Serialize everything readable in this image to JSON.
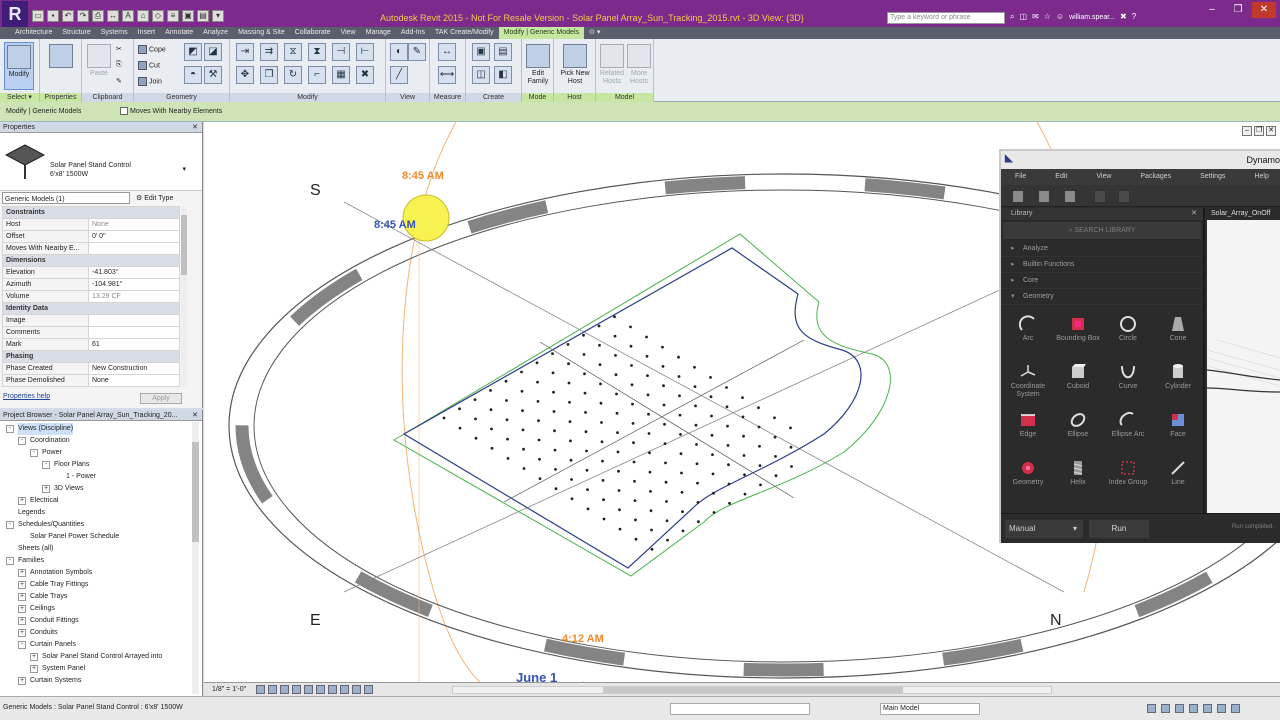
{
  "app": {
    "logo": "R",
    "window_title": "Autodesk Revit 2015 - Not For Resale Version -     Solar Panel Array_Sun_Tracking_2015.rvt - 3D View: {3D}",
    "search_placeholder": "Type a keyword or phrase",
    "user": "william.spear...",
    "colors": {
      "title_bar": "#7c2a8c",
      "title_text": "#f7c84a",
      "context_tab": "#c7e6a2"
    }
  },
  "ribbon_tabs": [
    "Architecture",
    "Structure",
    "Systems",
    "Insert",
    "Annotate",
    "Analyze",
    "Massing & Site",
    "Collaborate",
    "View",
    "Manage",
    "Add-Ins",
    "TAK Create/Modify",
    "Modify | Generic Models"
  ],
  "ribbon": {
    "select": {
      "big": "Modify",
      "label": "Select ▾"
    },
    "properties": {
      "label": "Properties"
    },
    "clipboard": {
      "paste": "Paste",
      "label": "Clipboard"
    },
    "geometry": {
      "cope": "Cope",
      "cut": "Cut",
      "join": "Join",
      "label": "Geometry"
    },
    "modify": {
      "label": "Modify"
    },
    "view": {
      "label": "View"
    },
    "measure": {
      "label": "Measure"
    },
    "create": {
      "label": "Create"
    },
    "mode": {
      "edit_family": "Edit Family",
      "label": "Mode"
    },
    "host": {
      "pick_new_host": "Pick New Host",
      "label": "Host"
    },
    "model": {
      "related_hosts": "Related Hosts",
      "more_hosts": "More Hosts",
      "label": "Model"
    }
  },
  "options_bar": {
    "context": "Modify | Generic Models",
    "moves_with": "Moves With Nearby Elements"
  },
  "properties": {
    "title": "Properties",
    "type_name": "Solar Panel Stand Control",
    "type_sub": "6'x8' 1500W",
    "selector": "Generic Models (1)",
    "edit_type": "Edit Type",
    "rows": [
      {
        "cat": "Constraints"
      },
      {
        "k": "Host",
        "v": "None",
        "gray": true
      },
      {
        "k": "Offset",
        "v": "0' 0\""
      },
      {
        "k": "Moves With Nearby E...",
        "v": ""
      },
      {
        "cat": "Dimensions"
      },
      {
        "k": "Elevation",
        "v": "-41.803°"
      },
      {
        "k": "Azimuth",
        "v": "-104.981°"
      },
      {
        "k": "Volume",
        "v": "13.29 CF",
        "gray": true
      },
      {
        "cat": "Identity Data"
      },
      {
        "k": "Image",
        "v": ""
      },
      {
        "k": "Comments",
        "v": ""
      },
      {
        "k": "Mark",
        "v": "61"
      },
      {
        "cat": "Phasing"
      },
      {
        "k": "Phase Created",
        "v": "New Construction"
      },
      {
        "k": "Phase Demolished",
        "v": "None"
      }
    ],
    "help": "Properties help",
    "apply": "Apply"
  },
  "browser": {
    "title": "Project Browser - Solar Panel Array_Sun_Tracking_20...",
    "nodes": [
      {
        "t": "Views (Discipline)",
        "d": 0,
        "e": "-",
        "hl": true
      },
      {
        "t": "Coordination",
        "d": 1,
        "e": "-"
      },
      {
        "t": "Power",
        "d": 2,
        "e": "-"
      },
      {
        "t": "Floor Plans",
        "d": 3,
        "e": "-"
      },
      {
        "t": "1 - Power",
        "d": 4,
        "e": ""
      },
      {
        "t": "3D Views",
        "d": 3,
        "e": "+"
      },
      {
        "t": "Electrical",
        "d": 1,
        "e": "+"
      },
      {
        "t": "Legends",
        "d": 0,
        "e": ""
      },
      {
        "t": "Schedules/Quantities",
        "d": 0,
        "e": "-"
      },
      {
        "t": "Solar Panel Power Schedule",
        "d": 1,
        "e": ""
      },
      {
        "t": "Sheets (all)",
        "d": 0,
        "e": ""
      },
      {
        "t": "Families",
        "d": 0,
        "e": "-"
      },
      {
        "t": "Annotation Symbols",
        "d": 1,
        "e": "+"
      },
      {
        "t": "Cable Tray Fittings",
        "d": 1,
        "e": "+"
      },
      {
        "t": "Cable Trays",
        "d": 1,
        "e": "+"
      },
      {
        "t": "Ceilings",
        "d": 1,
        "e": "+"
      },
      {
        "t": "Conduit Fittings",
        "d": 1,
        "e": "+"
      },
      {
        "t": "Conduits",
        "d": 1,
        "e": "+"
      },
      {
        "t": "Curtain Panels",
        "d": 1,
        "e": "-"
      },
      {
        "t": "Solar Panel Stand Control Arrayed into",
        "d": 2,
        "e": "+"
      },
      {
        "t": "System Panel",
        "d": 2,
        "e": "+"
      },
      {
        "t": "Curtain Systems",
        "d": 1,
        "e": "+"
      }
    ]
  },
  "viewport": {
    "compass": {
      "s": "S",
      "e": "E",
      "n": "N"
    },
    "times": {
      "t1": "8:45 AM",
      "t2": "8:45 AM",
      "t3": "4:12 AM"
    },
    "date": "June 1"
  },
  "dynamo": {
    "title": "Dynamo",
    "menu": [
      "File",
      "Edit",
      "View",
      "Packages",
      "Settings",
      "Help"
    ],
    "library_label": "Library",
    "search": "SEARCH LIBRARY",
    "categories": [
      {
        "name": "Analyze",
        "open": false
      },
      {
        "name": "Builtin Functions",
        "open": false
      },
      {
        "name": "Core",
        "open": false
      },
      {
        "name": "Geometry",
        "open": true
      }
    ],
    "nodes": [
      {
        "name": "Arc",
        "icon": "arc-icon"
      },
      {
        "name": "Bounding Box",
        "icon": "bounding-box-icon"
      },
      {
        "name": "Circle",
        "icon": "circle-icon"
      },
      {
        "name": "Cone",
        "icon": "cone-icon"
      },
      {
        "name": "Coordinate System",
        "icon": "coordinate-system-icon"
      },
      {
        "name": "Cuboid",
        "icon": "cuboid-icon"
      },
      {
        "name": "Curve",
        "icon": "curve-icon"
      },
      {
        "name": "Cylinder",
        "icon": "cylinder-icon"
      },
      {
        "name": "Edge",
        "icon": "edge-icon"
      },
      {
        "name": "Ellipse",
        "icon": "ellipse-icon"
      },
      {
        "name": "Ellipse Arc",
        "icon": "ellipse-arc-icon"
      },
      {
        "name": "Face",
        "icon": "face-icon"
      },
      {
        "name": "Geometry",
        "icon": "geometry-icon"
      },
      {
        "name": "Helix",
        "icon": "helix-icon"
      },
      {
        "name": "Index Group",
        "icon": "index-group-icon"
      },
      {
        "name": "Line",
        "icon": "line-icon"
      }
    ],
    "canvas_tab": "Solar_Array_OnOff",
    "run_mode": "Manual",
    "run": "Run",
    "status": "Run completed."
  },
  "view_control": {
    "scale": "1/8\" = 1'-0\""
  },
  "status_bar": {
    "text": "Generic Models : Solar Panel Stand Control : 6'x8' 1500W",
    "model": "Main Model"
  }
}
